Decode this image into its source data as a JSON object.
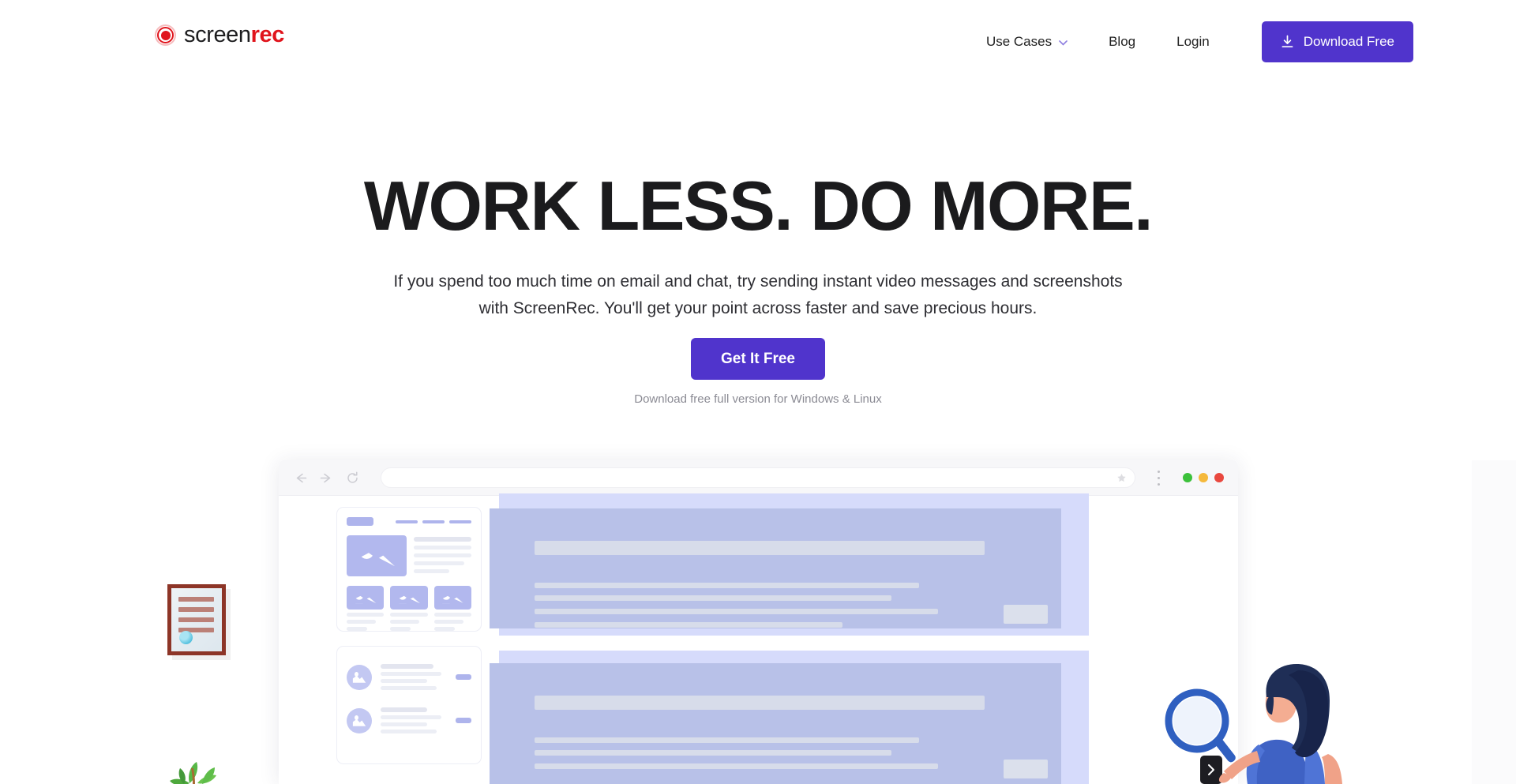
{
  "brand": {
    "name_light": "screen",
    "name_bold": "rec",
    "logo_icon": "record-dot-icon",
    "accent_red": "#e0141c"
  },
  "header": {
    "nav_items": [
      {
        "label": "Use Cases",
        "has_dropdown": true,
        "icon": "chevron-down-icon"
      },
      {
        "label": "Blog",
        "has_dropdown": false
      },
      {
        "label": "Login",
        "has_dropdown": false
      }
    ],
    "download_button": {
      "label": "Download Free",
      "icon": "download-icon",
      "color": "#5034cc"
    }
  },
  "hero": {
    "headline": "WORK LESS. DO MORE.",
    "subheadline": "If you spend too much time on email and chat, try sending instant video messages and screenshots with ScreenRec. You'll get your point across faster and save precious hours.",
    "cta_label": "Get It Free",
    "cta_color": "#5034cc",
    "cta_note": "Download free full version for Windows & Linux"
  },
  "mockup": {
    "browser_bar": {
      "back_icon": "arrow-left-icon",
      "forward_icon": "arrow-right-icon",
      "reload_icon": "reload-icon",
      "url_value": "",
      "url_placeholder": "",
      "bookmark_icon": "star-icon",
      "menu_icon": "kebab-menu-icon",
      "window_dots": [
        "#3cc13b",
        "#f5b93c",
        "#e9483f"
      ]
    },
    "sidebar_cards": [
      {
        "name": "article-card",
        "icon": "image-placeholder-icon"
      },
      {
        "name": "list-card",
        "icon": "avatar-placeholder-icon"
      }
    ],
    "selection_overlay": {
      "name": "capture-selection",
      "light_color": "#d6dbfb",
      "selected_color": "#b8c1e8"
    }
  },
  "decor": {
    "certificate": {
      "name": "framed-certificate-illustration",
      "frame_color": "#8d3527",
      "seal_color": "#59c3e0"
    },
    "plant": {
      "name": "plant-illustration",
      "color": "#4ea83c"
    },
    "person": {
      "name": "woman-with-magnifier-illustration",
      "hair_color": "#1f2e56",
      "shirt_color": "#3f62c4",
      "magnifier_color": "#2f5fc0",
      "badge_icon": "chevron-right-icon"
    }
  }
}
